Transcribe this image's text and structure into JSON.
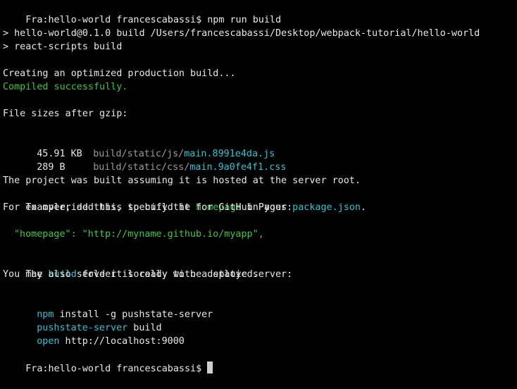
{
  "prompt": "Fra:hello-world francescabassi$",
  "command": "npm run build",
  "npm_header": "> hello-world@0.1.0 build /Users/francescabassi/Desktop/webpack-tutorial/hello-world",
  "npm_script": "> react-scripts build",
  "creating": "Creating an optimized production build...",
  "compiled": "Compiled successfully.",
  "sizes_title": "File sizes after gzip:",
  "files": [
    {
      "size": "45.91 KB",
      "dir": "build/static/js/",
      "name": "main.8991e4da.js"
    },
    {
      "size": "289 B",
      "dir": "build/static/css/",
      "name": "main.9a0fe4f1.css"
    }
  ],
  "hosted": {
    "line1": "The project was built assuming it is hosted at the server root.",
    "line2_a": "To override this, specify the ",
    "line2_b": "homepage",
    "line2_c": " in your ",
    "line2_d": "package.json",
    "line2_e": ".",
    "line3": "For example, add this to build it for GitHub Pages:"
  },
  "homepage_example": "\"homepage\": \"http://myname.github.io/myapp\",",
  "deploy": {
    "a": "The ",
    "b": "build",
    "c": " folder is ready to be deployed.",
    "line2": "You may also serve it locally with a static server:"
  },
  "serve": [
    {
      "cmd": "npm",
      "rest": " install -g pushstate-server"
    },
    {
      "cmd": "pushstate-server",
      "rest": " build"
    },
    {
      "cmd": "open",
      "rest": " http://localhost:9000"
    }
  ],
  "final_prompt": "Fra:hello-world francescabassi$"
}
